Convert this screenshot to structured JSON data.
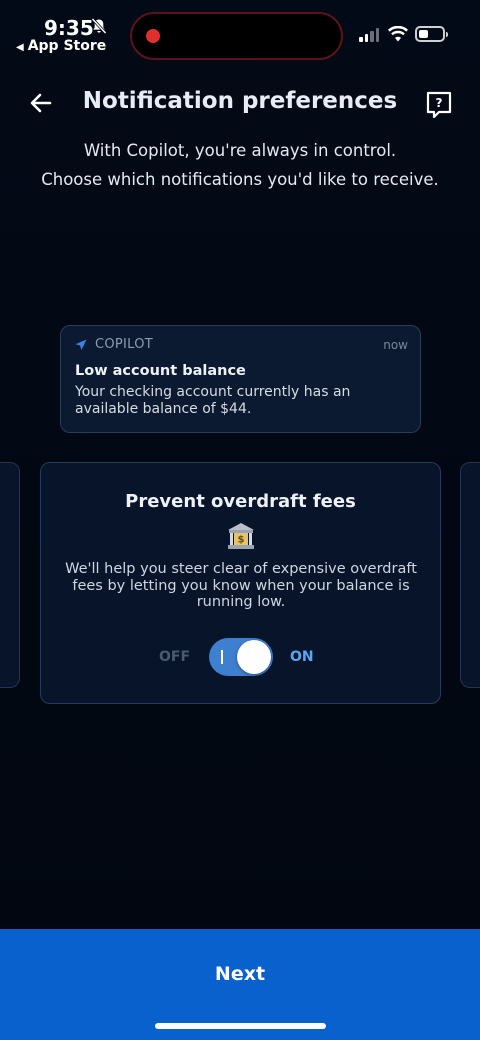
{
  "status_bar": {
    "time": "9:35",
    "back_app": "App Store",
    "icons": [
      "bell-slash-icon",
      "recording-dot-icon",
      "signal-icon",
      "wifi-icon",
      "battery-icon"
    ]
  },
  "header": {
    "title": "Notification preferences",
    "back_icon": "arrow-left-icon",
    "help_icon": "question-bubble-icon"
  },
  "subtitle": {
    "line1": "With Copilot, you're always in control.",
    "line2": "Choose which notifications you'd like to receive."
  },
  "notification_preview": {
    "app_name": "COPILOT",
    "time": "now",
    "title": "Low account balance",
    "body": "Your checking account currently has an available balance of $44."
  },
  "card": {
    "title": "Prevent overdraft fees",
    "icon": "bank-icon",
    "description": "We'll help you steer clear of expensive overdraft fees by letting you know when your balance is running low.",
    "off_label": "OFF",
    "on_label": "ON",
    "toggle_state": "on"
  },
  "footer": {
    "next_label": "Next"
  },
  "colors": {
    "background": "#020711",
    "accent": "#0861cc",
    "toggle_on": "#3f7fcf",
    "on_label": "#5aa6f4"
  }
}
